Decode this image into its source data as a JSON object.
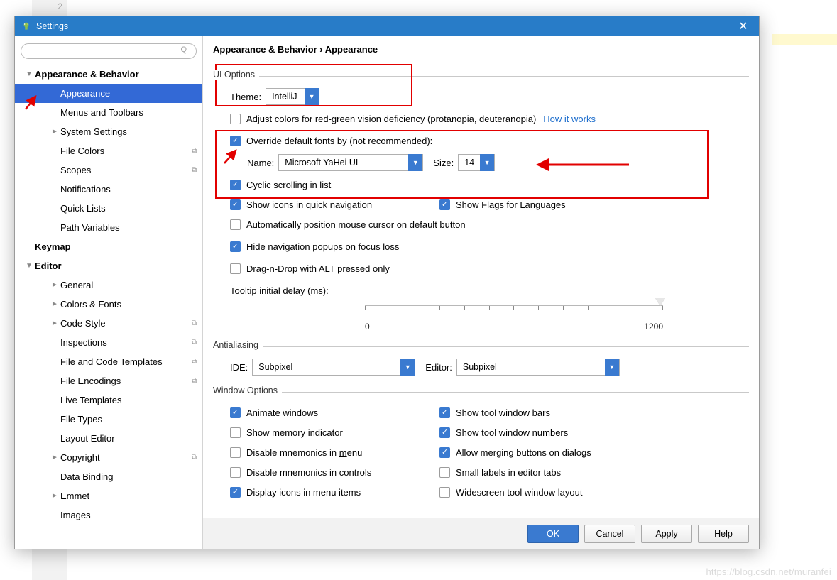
{
  "gutterLine": "2",
  "titlebar": {
    "title": "Settings"
  },
  "search": {
    "placeholder": ""
  },
  "sidebar": {
    "items": [
      {
        "label": "Appearance & Behavior",
        "bold": true,
        "arrow": "▼",
        "indent": 0
      },
      {
        "label": "Appearance",
        "indent": 2,
        "selected": true
      },
      {
        "label": "Menus and Toolbars",
        "indent": 2
      },
      {
        "label": "System Settings",
        "indent": 2,
        "arrow": "►"
      },
      {
        "label": "File Colors",
        "indent": 2,
        "share": true
      },
      {
        "label": "Scopes",
        "indent": 2,
        "share": true
      },
      {
        "label": "Notifications",
        "indent": 2
      },
      {
        "label": "Quick Lists",
        "indent": 2
      },
      {
        "label": "Path Variables",
        "indent": 2
      },
      {
        "label": "Keymap",
        "bold": true,
        "indent": 0
      },
      {
        "label": "Editor",
        "bold": true,
        "arrow": "▼",
        "indent": 0
      },
      {
        "label": "General",
        "indent": 2,
        "arrow": "►"
      },
      {
        "label": "Colors & Fonts",
        "indent": 2,
        "arrow": "►"
      },
      {
        "label": "Code Style",
        "indent": 2,
        "arrow": "►",
        "share": true
      },
      {
        "label": "Inspections",
        "indent": 2,
        "share": true
      },
      {
        "label": "File and Code Templates",
        "indent": 2,
        "share": true
      },
      {
        "label": "File Encodings",
        "indent": 2,
        "share": true
      },
      {
        "label": "Live Templates",
        "indent": 2
      },
      {
        "label": "File Types",
        "indent": 2
      },
      {
        "label": "Layout Editor",
        "indent": 2
      },
      {
        "label": "Copyright",
        "indent": 2,
        "arrow": "►",
        "share": true
      },
      {
        "label": "Data Binding",
        "indent": 2
      },
      {
        "label": "Emmet",
        "indent": 2,
        "arrow": "►"
      },
      {
        "label": "Images",
        "indent": 2
      }
    ]
  },
  "breadcrumb": "Appearance & Behavior › Appearance",
  "ui_options": {
    "section": "UI Options",
    "theme_label": "Theme:",
    "theme_value": "IntelliJ",
    "adjust_colors": {
      "checked": false,
      "label": "Adjust colors for red-green vision deficiency (protanopia, deuteranopia)",
      "link": "How it works"
    },
    "override_fonts": {
      "checked": true,
      "label": "Override default fonts by (not recommended):"
    },
    "font_name_label": "Name:",
    "font_name_value": "Microsoft YaHei UI",
    "font_size_label": "Size:",
    "font_size_value": "14",
    "cyclic": {
      "checked": true,
      "label": "Cyclic scrolling in list"
    },
    "show_icons": {
      "checked": true,
      "label": "Show icons in quick navigation"
    },
    "show_flags": {
      "checked": true,
      "label": "Show Flags for Languages"
    },
    "auto_cursor": {
      "checked": false,
      "label": "Automatically position mouse cursor on default button"
    },
    "hide_popups": {
      "checked": true,
      "label": "Hide navigation popups on focus loss"
    },
    "dnd_alt": {
      "checked": false,
      "label": "Drag-n-Drop with ALT pressed only"
    },
    "tooltip_delay_label": "Tooltip initial delay (ms):",
    "slider": {
      "min": "0",
      "max": "1200",
      "value": "1200"
    }
  },
  "antialiasing": {
    "section": "Antialiasing",
    "ide_label": "IDE:",
    "ide_value": "Subpixel",
    "editor_label": "Editor:",
    "editor_value": "Subpixel"
  },
  "window_options": {
    "section": "Window Options",
    "animate": {
      "checked": true,
      "label": "Animate windows"
    },
    "show_bars": {
      "checked": true,
      "label": "Show tool window bars"
    },
    "mem": {
      "checked": false,
      "label": "Show memory indicator"
    },
    "show_nums": {
      "checked": true,
      "label": "Show tool window numbers"
    },
    "dis_menu_pre": "Disable mnemonics in ",
    "dis_menu_u": "m",
    "dis_menu_post": "enu",
    "allow_merge": {
      "checked": true,
      "label": "Allow merging buttons on dialogs"
    },
    "dis_ctrl": {
      "checked": false,
      "label": "Disable mnemonics in controls"
    },
    "small_labels": {
      "checked": false,
      "label": "Small labels in editor tabs"
    },
    "disp_icons": {
      "checked": true,
      "label": "Display icons in menu items"
    },
    "widescreen": {
      "checked": false,
      "label": "Widescreen tool window layout"
    }
  },
  "buttons": {
    "ok": "OK",
    "cancel": "Cancel",
    "apply": "Apply",
    "help": "Help"
  },
  "watermark": "https://blog.csdn.net/muranfei"
}
